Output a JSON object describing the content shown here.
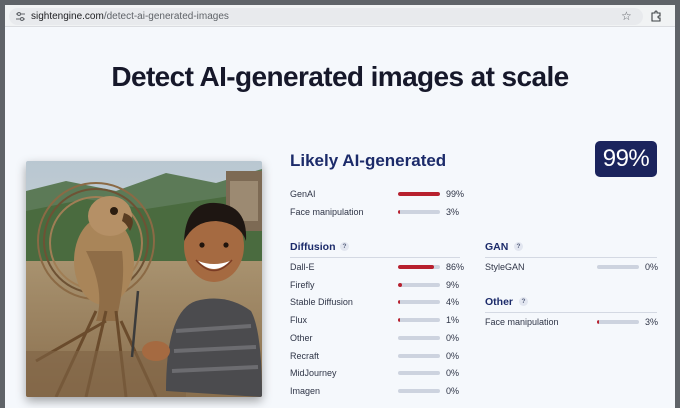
{
  "browser": {
    "url_domain": "sightengine.com",
    "url_path": "/detect-ai-generated-images",
    "site_icon": "tune-icon",
    "bookmark_icon": "star-icon",
    "extensions_icon": "puzzle-icon"
  },
  "page": {
    "title": "Detect AI-generated images at scale"
  },
  "result": {
    "verdict": "Likely AI-generated",
    "score": "99%",
    "summary": [
      {
        "label": "GenAI",
        "value": 0.99,
        "pct": "99%"
      },
      {
        "label": "Face manipulation",
        "value": 0.03,
        "pct": "3%"
      }
    ]
  },
  "sections": {
    "diffusion": {
      "title": "Diffusion",
      "help": "?",
      "rows": [
        {
          "label": "Dall-E",
          "value": 0.86,
          "pct": "86%"
        },
        {
          "label": "Firefly",
          "value": 0.09,
          "pct": "9%"
        },
        {
          "label": "Stable Diffusion",
          "value": 0.04,
          "pct": "4%"
        },
        {
          "label": "Flux",
          "value": 0.01,
          "pct": "1%"
        },
        {
          "label": "Other",
          "value": 0.0,
          "pct": "0%"
        },
        {
          "label": "Recraft",
          "value": 0.0,
          "pct": "0%"
        },
        {
          "label": "MidJourney",
          "value": 0.0,
          "pct": "0%"
        },
        {
          "label": "Imagen",
          "value": 0.0,
          "pct": "0%"
        }
      ]
    },
    "gan": {
      "title": "GAN",
      "help": "?",
      "rows": [
        {
          "label": "StyleGAN",
          "value": 0.0,
          "pct": "0%"
        }
      ]
    },
    "other": {
      "title": "Other",
      "help": "?",
      "rows": [
        {
          "label": "Face manipulation",
          "value": 0.03,
          "pct": "3%"
        }
      ]
    }
  },
  "colors": {
    "accent": "#1c2b6a",
    "badge": "#1b245d",
    "bar_fill": "#b8202e",
    "bar_track": "#cdd3df"
  }
}
